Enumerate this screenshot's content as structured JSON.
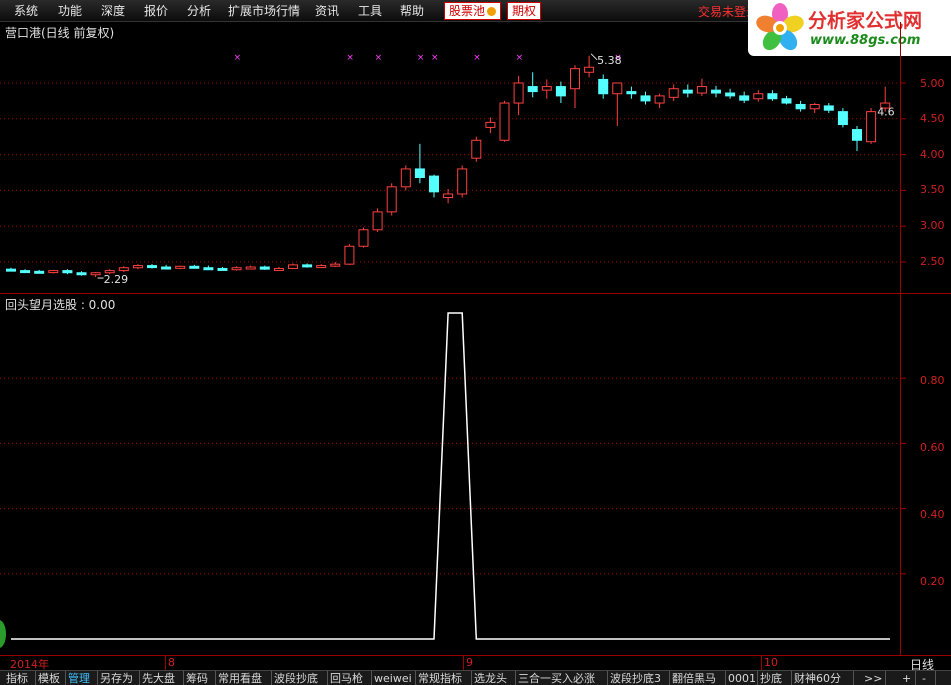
{
  "menu": {
    "items": [
      "系统",
      "功能",
      "深度",
      "报价",
      "分析",
      "扩展市场行情",
      "资讯",
      "工具",
      "帮助"
    ],
    "badge_pool": "股票池",
    "badge_options": "期权",
    "user_status": "交易未登录"
  },
  "logo": {
    "title": "分析家公式网",
    "url": "www.88gs.com"
  },
  "main_chart": {
    "title": "营口港(日线 前复权)",
    "high_label": "5.38",
    "low_label": "2.29",
    "last_label": "4.6",
    "yticks": [
      "5.00",
      "4.50",
      "4.00",
      "3.50",
      "3.00",
      "2.50"
    ]
  },
  "sub_chart": {
    "title": "回头望月选股 : 0.00",
    "yticks": [
      "0.80",
      "0.60",
      "0.40",
      "0.20"
    ]
  },
  "date_axis": {
    "labels": [
      "2014年",
      "8",
      "9",
      "10"
    ],
    "period": "日线"
  },
  "tabs": [
    "指标",
    "模板",
    "管理",
    "另存为",
    "先大盘",
    "筹码",
    "常用看盘",
    "波段抄底",
    "回马枪",
    "weiwei",
    "常规指标",
    "选龙头",
    "三合一买入必涨",
    "波段抄底3",
    "翻倍黑马",
    "0001",
    "抄底",
    "财神60分",
    ">>",
    "+",
    "-"
  ],
  "colors": {
    "up": "#ff4040",
    "down": "#54ffff",
    "grid": "#9a0000",
    "marker": "#ff40ff",
    "line": "#ffffff"
  },
  "chart_data": [
    {
      "type": "candlestick",
      "title": "营口港(日线 前复权)",
      "ylim": [
        2.2,
        5.5
      ],
      "candles": [
        [
          2.4,
          2.42,
          2.37,
          2.38
        ],
        [
          2.38,
          2.4,
          2.35,
          2.37
        ],
        [
          2.37,
          2.39,
          2.35,
          2.36
        ],
        [
          2.36,
          2.39,
          2.34,
          2.38
        ],
        [
          2.38,
          2.4,
          2.33,
          2.35
        ],
        [
          2.35,
          2.37,
          2.31,
          2.33
        ],
        [
          2.33,
          2.36,
          2.29,
          2.35
        ],
        [
          2.35,
          2.4,
          2.33,
          2.38
        ],
        [
          2.38,
          2.44,
          2.36,
          2.42
        ],
        [
          2.42,
          2.47,
          2.4,
          2.45
        ],
        [
          2.45,
          2.47,
          2.41,
          2.43
        ],
        [
          2.43,
          2.46,
          2.4,
          2.42
        ],
        [
          2.42,
          2.45,
          2.4,
          2.44
        ],
        [
          2.44,
          2.46,
          2.41,
          2.42
        ],
        [
          2.42,
          2.45,
          2.39,
          2.41
        ],
        [
          2.41,
          2.43,
          2.38,
          2.4
        ],
        [
          2.4,
          2.44,
          2.38,
          2.42
        ],
        [
          2.42,
          2.45,
          2.4,
          2.43
        ],
        [
          2.43,
          2.45,
          2.39,
          2.4
        ],
        [
          2.4,
          2.43,
          2.38,
          2.41
        ],
        [
          2.41,
          2.48,
          2.4,
          2.46
        ],
        [
          2.46,
          2.48,
          2.42,
          2.44
        ],
        [
          2.44,
          2.47,
          2.42,
          2.45
        ],
        [
          2.45,
          2.5,
          2.43,
          2.47
        ],
        [
          2.47,
          2.75,
          2.46,
          2.72
        ],
        [
          2.72,
          2.98,
          2.7,
          2.95
        ],
        [
          2.95,
          3.25,
          2.92,
          3.2
        ],
        [
          3.2,
          3.6,
          3.15,
          3.55
        ],
        [
          3.55,
          3.85,
          3.5,
          3.8
        ],
        [
          3.8,
          4.15,
          3.6,
          3.68
        ],
        [
          3.7,
          3.72,
          3.4,
          3.48
        ],
        [
          3.4,
          3.52,
          3.32,
          3.45
        ],
        [
          3.45,
          3.85,
          3.4,
          3.8
        ],
        [
          3.95,
          4.25,
          3.9,
          4.2
        ],
        [
          4.38,
          4.52,
          4.3,
          4.45
        ],
        [
          4.2,
          4.75,
          4.18,
          4.72
        ],
        [
          4.72,
          5.1,
          4.55,
          5.0
        ],
        [
          4.95,
          5.15,
          4.8,
          4.88
        ],
        [
          4.9,
          5.05,
          4.78,
          4.95
        ],
        [
          4.95,
          5.02,
          4.72,
          4.82
        ],
        [
          4.92,
          5.25,
          4.65,
          5.2
        ],
        [
          5.15,
          5.38,
          5.08,
          5.22
        ],
        [
          5.05,
          5.12,
          4.78,
          4.85
        ],
        [
          4.85,
          5.0,
          4.4,
          5.0
        ],
        [
          4.88,
          4.95,
          4.78,
          4.85
        ],
        [
          4.82,
          4.88,
          4.7,
          4.75
        ],
        [
          4.72,
          4.85,
          4.65,
          4.82
        ],
        [
          4.8,
          4.98,
          4.75,
          4.92
        ],
        [
          4.9,
          4.98,
          4.8,
          4.86
        ],
        [
          4.86,
          5.06,
          4.82,
          4.95
        ],
        [
          4.9,
          4.96,
          4.8,
          4.86
        ],
        [
          4.86,
          4.92,
          4.78,
          4.82
        ],
        [
          4.82,
          4.88,
          4.72,
          4.76
        ],
        [
          4.78,
          4.9,
          4.74,
          4.85
        ],
        [
          4.85,
          4.9,
          4.75,
          4.78
        ],
        [
          4.78,
          4.82,
          4.7,
          4.72
        ],
        [
          4.7,
          4.75,
          4.6,
          4.64
        ],
        [
          4.64,
          4.72,
          4.58,
          4.7
        ],
        [
          4.68,
          4.72,
          4.58,
          4.62
        ],
        [
          4.6,
          4.65,
          4.38,
          4.42
        ],
        [
          4.35,
          4.4,
          4.05,
          4.2
        ],
        [
          4.18,
          4.65,
          4.15,
          4.6
        ],
        [
          4.65,
          4.95,
          4.6,
          4.72
        ]
      ]
    },
    {
      "type": "line",
      "title": "回头望月选股 : 0.00",
      "ylim": [
        0,
        1
      ],
      "values": [
        0,
        0,
        0,
        0,
        0,
        0,
        0,
        0,
        0,
        0,
        0,
        0,
        0,
        0,
        0,
        0,
        0,
        0,
        0,
        0,
        0,
        0,
        0,
        0,
        0,
        0,
        0,
        0,
        0,
        0,
        0,
        1,
        1,
        0,
        0,
        0,
        0,
        0,
        0,
        0,
        0,
        0,
        0,
        0,
        0,
        0,
        0,
        0,
        0,
        0,
        0,
        0,
        0,
        0,
        0,
        0,
        0,
        0,
        0,
        0,
        0,
        0,
        0
      ]
    }
  ]
}
